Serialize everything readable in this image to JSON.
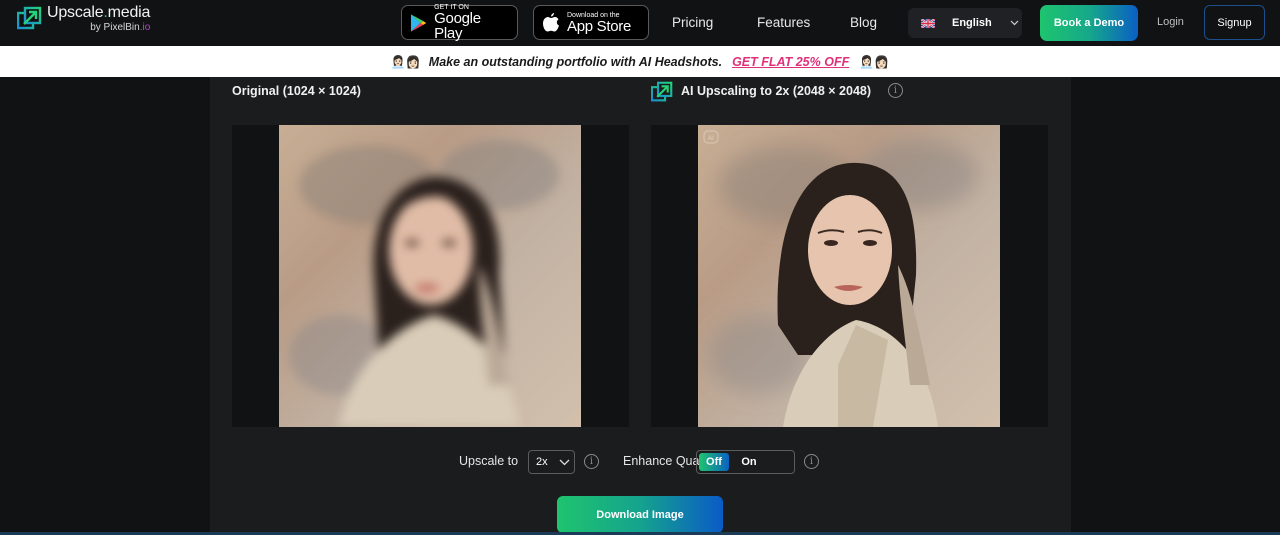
{
  "header": {
    "logo": {
      "title_main": "Upscale",
      "title_dot": ".",
      "title_suffix": "media",
      "sub_prefix": "by PixelBin",
      "sub_suffix": ".io"
    },
    "google_play": {
      "small": "GET IT ON",
      "big": "Google Play"
    },
    "app_store": {
      "small": "Download on the",
      "big": "App Store"
    },
    "nav": [
      {
        "label": "Pricing"
      },
      {
        "label": "Features"
      },
      {
        "label": "Blog"
      }
    ],
    "language": {
      "icon": "uk-flag-icon",
      "label": "English"
    },
    "book_demo": "Book a Demo",
    "login": "Login",
    "signup": "Signup"
  },
  "promo": {
    "emoji": "👩🏻‍💼👩🏻",
    "text": "Make an outstanding portfolio with AI Headshots.",
    "link": "GET FLAT 25% OFF"
  },
  "main": {
    "original_title": "Original (1024 × 1024)",
    "upscaled_title": "AI Upscaling to 2x (2048 × 2048)",
    "ai_badge": "AI",
    "controls": {
      "upscale_label": "Upscale to",
      "upscale_value": "2x",
      "enhance_label": "Enhance Quality",
      "enhance_off": "Off",
      "enhance_on": "On",
      "enhance_state": "Off"
    },
    "download": "Download Image"
  },
  "colors": {
    "accent_green": "#1ec46e",
    "accent_blue": "#0a5bc6",
    "promo_pink": "#e0307a",
    "background": "#111214",
    "panel": "#1b1c1e"
  }
}
